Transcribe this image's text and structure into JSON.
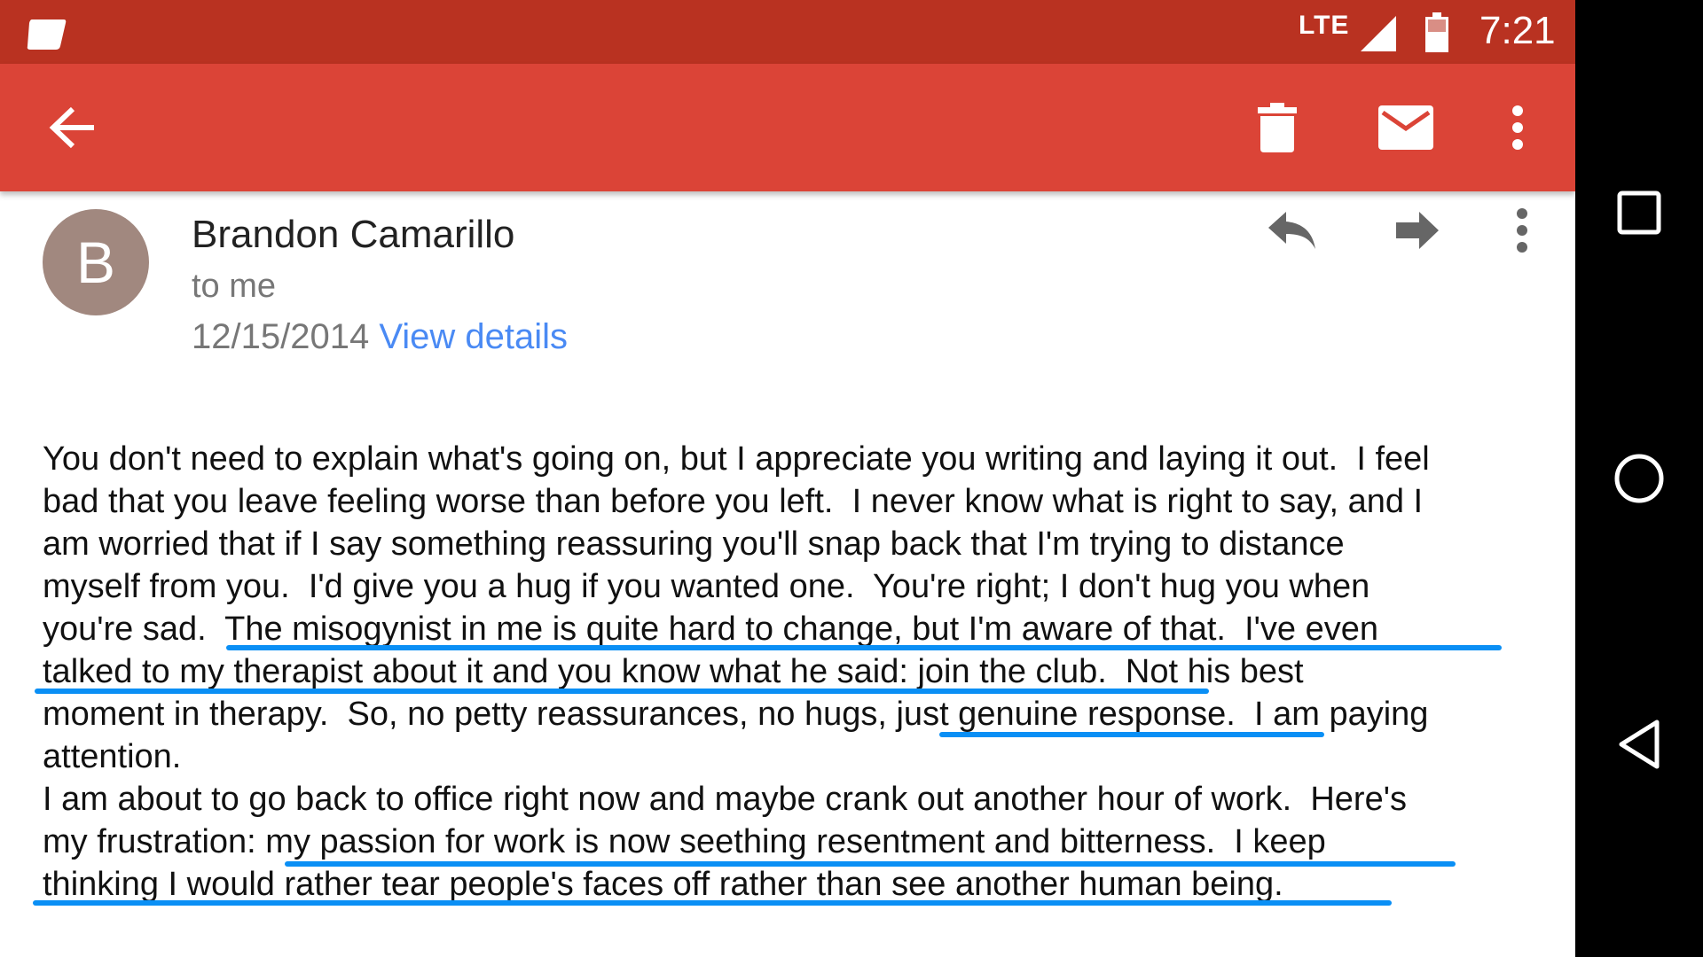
{
  "status_bar": {
    "network": "LTE",
    "time": "7:21"
  },
  "toolbar": {
    "icons": [
      "back-arrow-icon",
      "trash-icon",
      "mail-icon",
      "more-vert-icon"
    ],
    "color": "#db4437",
    "status_color": "#b93221"
  },
  "message": {
    "avatar_letter": "B",
    "avatar_color": "#a1887f",
    "sender": "Brandon Camarillo",
    "recipient": "to me",
    "date": "12/15/2014",
    "view_details": "View details",
    "actions": [
      "reply-icon",
      "forward-icon",
      "more-vert-icon"
    ],
    "body_lines": [
      "You don't need to explain what's going on, but I appreciate you writing and laying it out.  I feel",
      "bad that you leave feeling worse than before you left.  I never know what is right to say, and I",
      "am worried that if I say something reassuring you'll snap back that I'm trying to distance",
      "myself from you.  I'd give you a hug if you wanted one.  You're right; I don't hug you when",
      "you're sad.  The misogynist in me is quite hard to change, but I'm aware of that.  I've even",
      "talked to my therapist about it and you know what he said: join the club.  Not his best",
      "moment in therapy.  So, no petty reassurances, no hugs, just genuine response.  I am paying",
      "attention.",
      "I am about to go back to office right now and maybe crank out another hour of work.  Here's",
      "my frustration: my passion for work is now seething resentment and bitterness.  I keep",
      "thinking I would rather tear people's faces off rather than see another human being."
    ]
  },
  "annotation_color": "#0a8ff5",
  "navigation_bar": {
    "icons": [
      "recents-square-icon",
      "home-circle-icon",
      "back-triangle-icon"
    ]
  }
}
